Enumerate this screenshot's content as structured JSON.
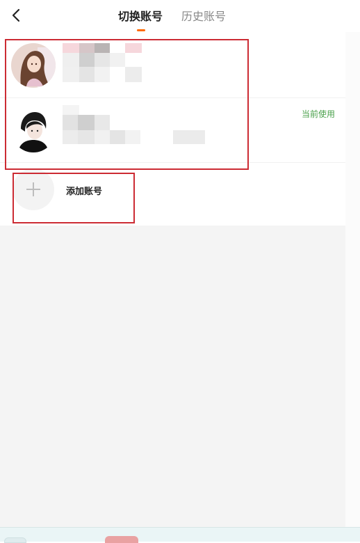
{
  "header": {
    "tabs": [
      {
        "label": "切换账号",
        "active": true
      },
      {
        "label": "历史账号",
        "active": false
      }
    ],
    "back_icon": "chevron-left-icon",
    "accent_color": "#ff6a00"
  },
  "accounts": [
    {
      "avatar_icon": "avatar-girl",
      "status": ""
    },
    {
      "avatar_icon": "avatar-boy",
      "status": "当前使用",
      "status_color": "#49a04a"
    }
  ],
  "add_account": {
    "label": "添加账号",
    "icon": "plus-icon"
  },
  "annotations": {
    "highlight_color": "#cc2b33"
  }
}
